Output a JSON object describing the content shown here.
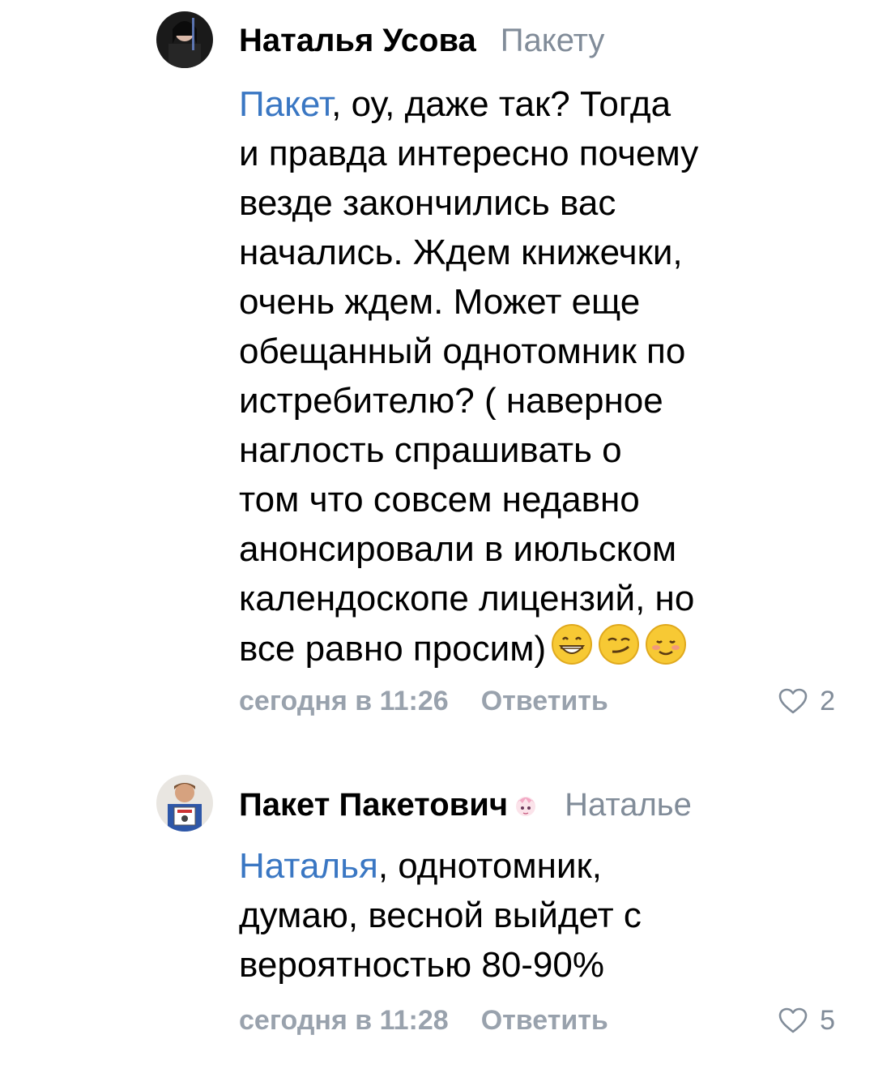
{
  "comments": [
    {
      "author": "Наталья Усова",
      "reply_to": "Пакету",
      "mention": "Пакет",
      "text_lines": [
        ", оу, даже так? Тогда",
        "и правда интересно почему",
        "везде закончились вас",
        "начались. Ждем книжечки,",
        "очень ждем. Может еще",
        "обещанный однотомник по",
        "истребителю? ( наверное",
        "наглость спрашивать о",
        "том что совсем недавно",
        "анонсировали в июльском",
        "календоскопе лицензий, но",
        "все равно просим)"
      ],
      "emojis": [
        "grinning-face-icon",
        "smirking-face-icon",
        "smiling-face-icon"
      ],
      "time": "сегодня в 11:26",
      "reply_label": "Ответить",
      "likes": "2"
    },
    {
      "author": "Пакет Пакетович",
      "reply_to": "Наталье",
      "mention": "Наталья",
      "text_lines": [
        ", однотомник,",
        "думаю, весной выйдет с",
        "вероятностью 80-90%"
      ],
      "time": "сегодня в 11:28",
      "reply_label": "Ответить",
      "likes": "5"
    }
  ],
  "colors": {
    "mention": "#3a77c3",
    "secondary": "#818c99",
    "text": "#000000",
    "background": "#ffffff"
  }
}
